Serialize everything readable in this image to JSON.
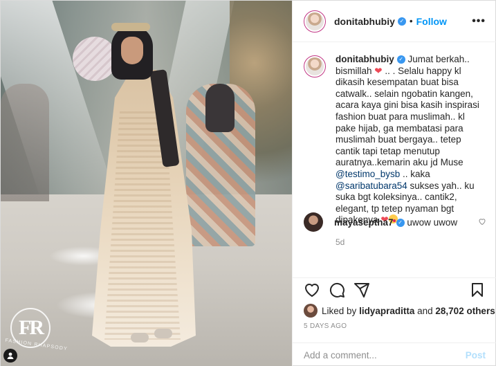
{
  "post": {
    "username": "donitabhubiy",
    "follow_label": "Follow",
    "more_label": "•••",
    "verified_icon": "verified-badge-icon",
    "caption_segments": [
      {
        "t": "text",
        "v": "Jumat berkah.. bismillah "
      },
      {
        "t": "heart",
        "v": "❤️"
      },
      {
        "t": "text",
        "v": " .. . Selalu happy kl dikasih kesempatan buat bisa catwalk.. selain ngobatin kangen, acara kaya gini bisa kasih inspirasi fashion buat para muslimah.. kl pake hijab, ga membatasi para muslimah buat bergaya.. tetep cantik tapi tetap menutup auratnya..kemarin aku jd Muse "
      },
      {
        "t": "mention",
        "v": "@testimo_bysb"
      },
      {
        "t": "text",
        "v": " .. kaka "
      },
      {
        "t": "mention",
        "v": "@saribatubara54"
      },
      {
        "t": "text",
        "v": " sukses yah.. ku suka bgt koleksinya.. cantik2, elegant, tp tetep nyaman bgt dipakenya "
      },
      {
        "t": "heart",
        "v": "❤️"
      },
      {
        "t": "wink",
        "v": "wink-emoji"
      }
    ],
    "caption_age": "5d",
    "comment": {
      "user": "mayaseptha7",
      "text": "uwow uwow"
    },
    "liked_by_prefix": "Liked by",
    "liked_by_user": "lidyapraditta",
    "liked_by_and": "and",
    "liked_by_count": "28,702 others",
    "date": "5 DAYS AGO",
    "add_comment_placeholder": "Add a comment...",
    "post_label": "Post",
    "image_brand_text": "FASHION RHAPSODY",
    "image_brand_mark": "FR"
  },
  "colors": {
    "link": "#0095f6",
    "verified": "#3897f0",
    "heart": "#ed4956",
    "muted": "#8e8e8e"
  }
}
